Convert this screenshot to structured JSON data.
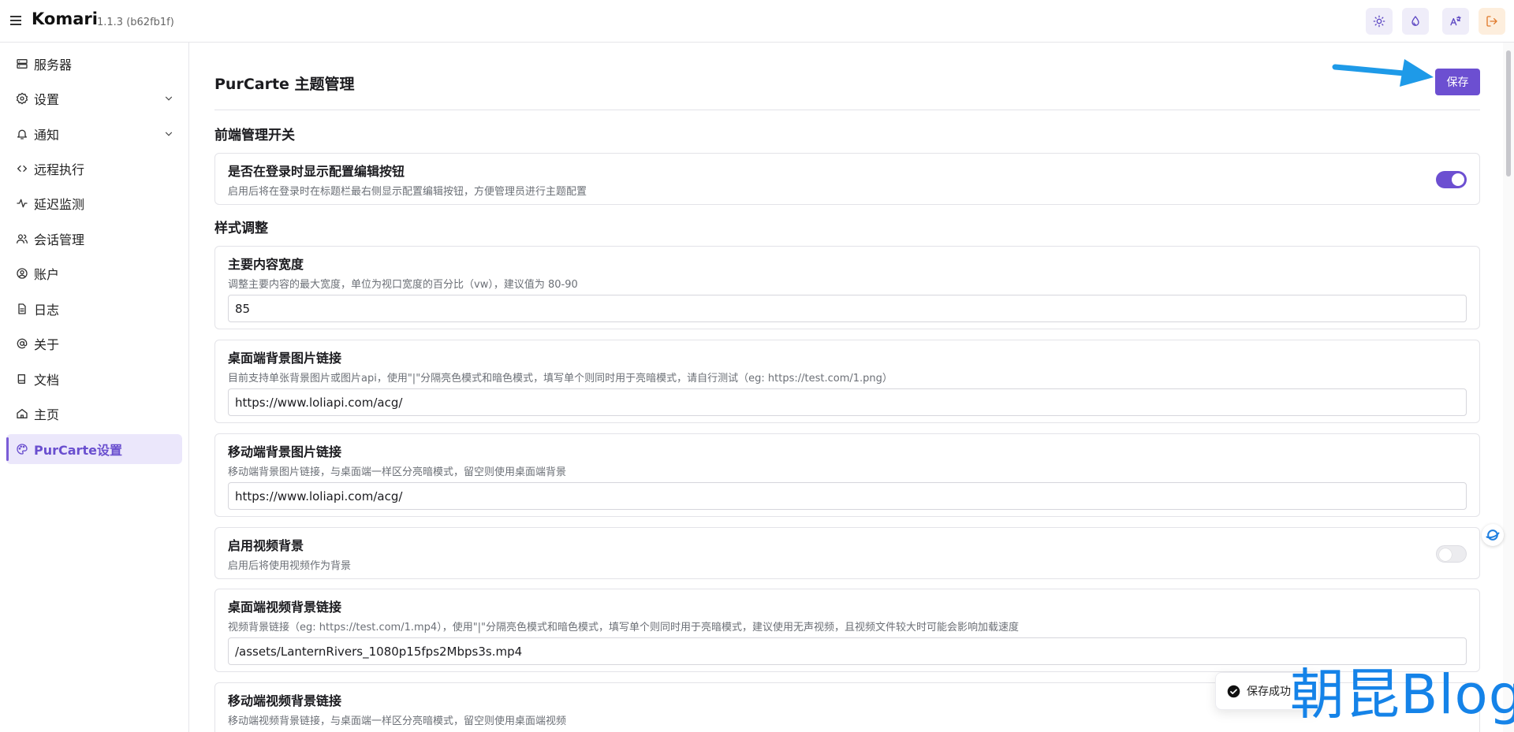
{
  "app": {
    "brand": "Komari",
    "version": "1.1.3 (b62fb1f)"
  },
  "header": {
    "buttons": [
      {
        "icon": "sun-icon"
      },
      {
        "icon": "droplet-icon"
      },
      {
        "icon": "translate-icon"
      },
      {
        "icon": "logout-icon"
      }
    ]
  },
  "sidebar": {
    "items": [
      {
        "label": "服务器",
        "icon": "server-icon"
      },
      {
        "label": "设置",
        "icon": "gear-icon",
        "expandable": true
      },
      {
        "label": "通知",
        "icon": "bell-icon",
        "expandable": true
      },
      {
        "label": "远程执行",
        "icon": "code-icon"
      },
      {
        "label": "延迟监测",
        "icon": "pulse-icon"
      },
      {
        "label": "会话管理",
        "icon": "users-icon"
      },
      {
        "label": "账户",
        "icon": "user-circle-icon"
      },
      {
        "label": "日志",
        "icon": "file-icon"
      },
      {
        "label": "关于",
        "icon": "at-icon"
      },
      {
        "label": "文档",
        "icon": "book-icon"
      },
      {
        "label": "主页",
        "icon": "home-icon"
      },
      {
        "label": "PurCarte设置",
        "icon": "palette-icon",
        "active": true
      }
    ]
  },
  "main": {
    "title": "PurCarte 主题管理",
    "save_label": "保存",
    "sections": {
      "frontend": "前端管理开关",
      "style": "样式调整"
    },
    "cards": {
      "config_edit": {
        "title": "是否在登录时显示配置编辑按钮",
        "desc": "启用后将在登录时在标题栏最右侧显示配置编辑按钮，方便管理员进行主题配置",
        "toggle": true
      },
      "content_width": {
        "title": "主要内容宽度",
        "desc": "调整主要内容的最大宽度，单位为视口宽度的百分比（vw），建议值为 80-90",
        "value": "85"
      },
      "desktop_bg": {
        "title": "桌面端背景图片链接",
        "desc": "目前支持单张背景图片或图片api，使用\"|\"分隔亮色模式和暗色模式，填写单个则同时用于亮暗模式，请自行测试（eg: https://test.com/1.png）",
        "value": "https://www.loliapi.com/acg/"
      },
      "mobile_bg": {
        "title": "移动端背景图片链接",
        "desc": "移动端背景图片链接，与桌面端一样区分亮暗模式，留空则使用桌面端背景",
        "value": "https://www.loliapi.com/acg/"
      },
      "video_bg": {
        "title": "启用视频背景",
        "desc": "启用后将使用视频作为背景",
        "toggle": false
      },
      "desktop_video": {
        "title": "桌面端视频背景链接",
        "desc": "视频背景链接（eg: https://test.com/1.mp4），使用\"|\"分隔亮色模式和暗色模式，填写单个则同时用于亮暗模式，建议使用无声视频，且视频文件较大时可能会影响加载速度",
        "value": "/assets/LanternRivers_1080p15fps2Mbps3s.mp4"
      },
      "mobile_video": {
        "title": "移动端视频背景链接",
        "desc": "移动端视频背景链接，与桌面端一样区分亮暗模式，留空则使用桌面端视频"
      }
    }
  },
  "toast": {
    "message": "保存成功"
  },
  "watermark": "朝昆Blog",
  "colors": {
    "accent": "#6c4fd1",
    "active_bg": "#ebe7fb",
    "watermark": "#1583e8"
  }
}
